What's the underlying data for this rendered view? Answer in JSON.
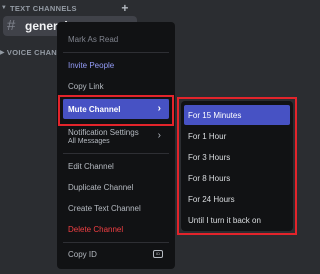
{
  "sidebar": {
    "categories": {
      "text_channels": "TEXT CHANNELS",
      "voice_channels": "VOICE CHANNELS"
    },
    "channel": {
      "name": "general",
      "icon": "hash-icon"
    }
  },
  "context_menu": {
    "mark_as_read": "Mark As Read",
    "invite_people": "Invite People",
    "copy_link": "Copy Link",
    "mute_channel": "Mute Channel",
    "notification_settings": "Notification Settings",
    "notification_sub": "All Messages",
    "edit_channel": "Edit Channel",
    "duplicate_channel": "Duplicate Channel",
    "create_text_channel": "Create Text Channel",
    "delete_channel": "Delete Channel",
    "copy_id": "Copy ID",
    "id_badge": "ID"
  },
  "mute_submenu": {
    "items": [
      "For 15 Minutes",
      "For 1 Hour",
      "For 3 Hours",
      "For 8 Hours",
      "For 24 Hours",
      "Until I turn it back on"
    ]
  },
  "colors": {
    "background": "#2b2d31",
    "menu": "#111214",
    "highlight": "#4752c4",
    "danger": "#f23f43",
    "annotation_outline": "#e3242b"
  }
}
